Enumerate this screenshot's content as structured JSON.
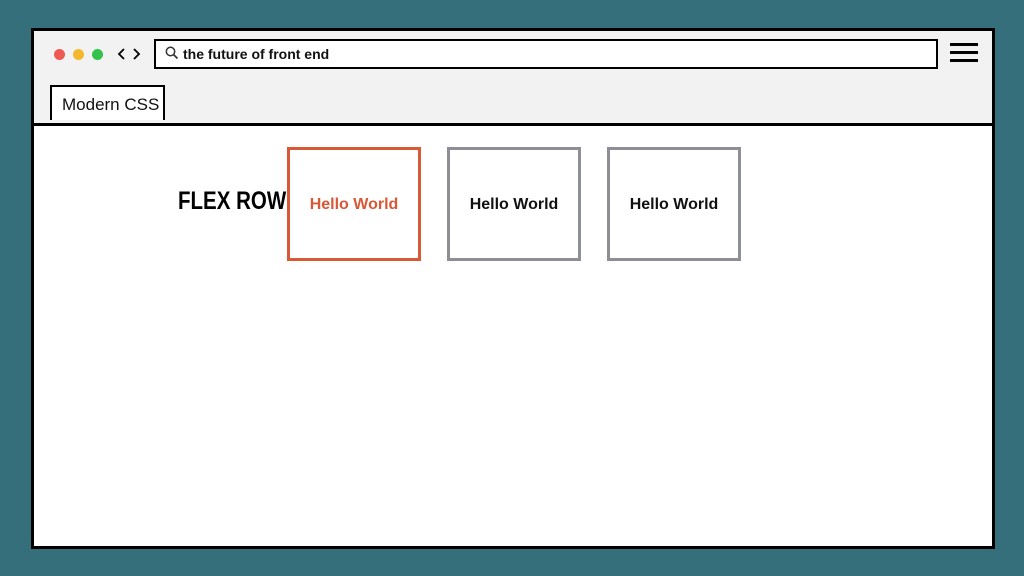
{
  "browser": {
    "address_bar": {
      "value": "the future of front end",
      "icon": "search-icon"
    },
    "tab": {
      "label": "Modern CSS"
    },
    "controls": {
      "traffic_lights": [
        "#ee5a52",
        "#f4b82c",
        "#32c34a"
      ],
      "nav": [
        "chevron-left-icon",
        "chevron-right-icon"
      ],
      "menu": "hamburger-menu-icon"
    }
  },
  "page": {
    "heading": "FLEX ROW",
    "boxes": [
      {
        "text": "Hello World",
        "highlighted": true
      },
      {
        "text": "Hello World",
        "highlighted": false
      },
      {
        "text": "Hello World",
        "highlighted": false
      }
    ]
  },
  "colors": {
    "background": "#346f7b",
    "accent": "#d95836",
    "box_border": "#8e8e96"
  }
}
